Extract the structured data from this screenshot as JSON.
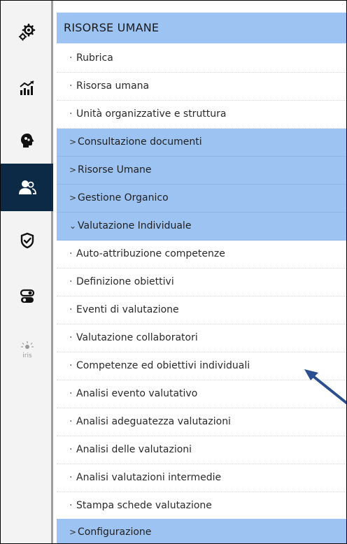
{
  "rail": {
    "items": [
      {
        "icon": "gears-icon"
      },
      {
        "icon": "chart-icon"
      },
      {
        "icon": "brain-head-icon"
      },
      {
        "icon": "people-icon",
        "active": true
      },
      {
        "icon": "shield-check-icon"
      },
      {
        "icon": "toggle-icon"
      },
      {
        "icon": "iris-logo-icon",
        "label": "iris"
      }
    ]
  },
  "menu": {
    "title": "RISORSE UMANE",
    "bullet": "·",
    "collapsed_chevron": ">",
    "expanded_chevron": "⌄",
    "items": [
      {
        "label": "Rubrica"
      },
      {
        "label": "Risorsa umana"
      },
      {
        "label": "Unità organizzative e struttura"
      },
      {
        "label": "Consultazione documenti"
      },
      {
        "label": "Risorse Umane"
      },
      {
        "label": "Gestione Organico"
      },
      {
        "label": "Valutazione Individuale"
      },
      {
        "label": "Auto-attribuzione competenze"
      },
      {
        "label": "Definizione obiettivi"
      },
      {
        "label": "Eventi di valutazione"
      },
      {
        "label": "Valutazione collaboratori"
      },
      {
        "label": "Competenze ed obiettivi individuali"
      },
      {
        "label": "Analisi evento valutativo"
      },
      {
        "label": "Analisi adeguatezza valutazioni"
      },
      {
        "label": "Analisi delle valutazioni"
      },
      {
        "label": "Analisi valutazioni intermedie"
      },
      {
        "label": "Stampa schede valutazione"
      },
      {
        "label": "Configurazione"
      }
    ]
  },
  "colors": {
    "section_bg": "#9cc3f1",
    "rail_active": "#0c2a46",
    "arrow": "#2b4f8e"
  }
}
